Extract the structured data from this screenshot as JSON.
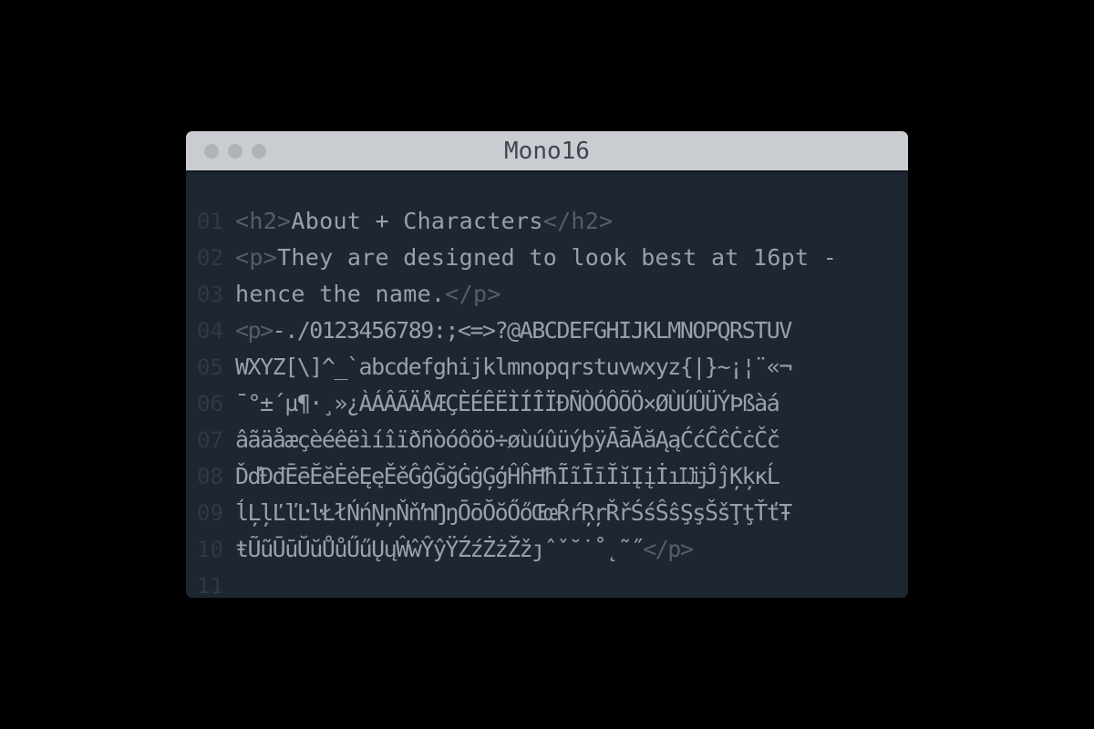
{
  "window": {
    "title": "Mono16"
  },
  "editor": {
    "lines": [
      {
        "num": "01",
        "parts": [
          {
            "t": "tag",
            "v": "<h2>"
          },
          {
            "t": "txt",
            "v": "About + Characters"
          },
          {
            "t": "tag",
            "v": "</h2>"
          }
        ]
      },
      {
        "num": "02",
        "parts": [
          {
            "t": "tag",
            "v": "<p>"
          },
          {
            "t": "txt",
            "v": "They are designed to look best at 16pt -"
          }
        ]
      },
      {
        "num": "03",
        "parts": [
          {
            "t": "txt",
            "v": "hence the name."
          },
          {
            "t": "tag",
            "v": "</p>"
          }
        ]
      },
      {
        "num": "04",
        "tight": true,
        "parts": [
          {
            "t": "tag",
            "v": "<p>"
          },
          {
            "t": "txt",
            "v": "-./0123456789:;<=>?@ABCDEFGHIJKLMNOPQRSTUV"
          }
        ]
      },
      {
        "num": "05",
        "tight": true,
        "parts": [
          {
            "t": "txt",
            "v": "WXYZ[\\]^_`abcdefghijklmnopqrstuvwxyz{|}~¡¦¨«¬"
          }
        ]
      },
      {
        "num": "06",
        "tight": true,
        "parts": [
          {
            "t": "txt",
            "v": "¯°±´µ¶·¸»¿ÀÁÂÃÄÅÆÇÈÉÊËÌÍÎÏÐÑÒÓÔÕÖ×ØÙÚÛÜÝÞßàá"
          }
        ]
      },
      {
        "num": "07",
        "tight": true,
        "parts": [
          {
            "t": "txt",
            "v": "âãäåæçèéêëìíîïðñòóôõö÷øùúûüýþÿĀāĂăĄąĆćĈĉĊċČč"
          }
        ]
      },
      {
        "num": "08",
        "tight": true,
        "parts": [
          {
            "t": "txt",
            "v": "ĎďĐđĒēĔĕĖėĘęĚěĜĝĞğĠġĢģĤĥĦħĨĩĪīĬĭĮįİıĲĳĴĵĶķĸĹ"
          }
        ]
      },
      {
        "num": "09",
        "tight": true,
        "parts": [
          {
            "t": "txt",
            "v": "ĺĻļĽľĿŀŁłŃńŅņŇňŉŊŋŌōŎŏŐőŒœŔŕŖŗŘřŚśŜŝŞşŠšŢţŤťŦ"
          }
        ]
      },
      {
        "num": "10",
        "tight": true,
        "parts": [
          {
            "t": "txt",
            "v": "ŧŨũŪūŬŭŮůŰűŲųŴŵŶŷŸŹźŻżŽžȷˆˇ˘˙˚˛˜˝"
          },
          {
            "t": "tag",
            "v": "</p>"
          }
        ]
      },
      {
        "num": "11",
        "parts": []
      }
    ]
  },
  "colors": {
    "background": "#000000",
    "titlebar": "#c9ccd0",
    "editor_bg": "#1d2631",
    "text": "#9aa0a8",
    "tag": "#545e6a",
    "line_number": "#2f3a46"
  }
}
